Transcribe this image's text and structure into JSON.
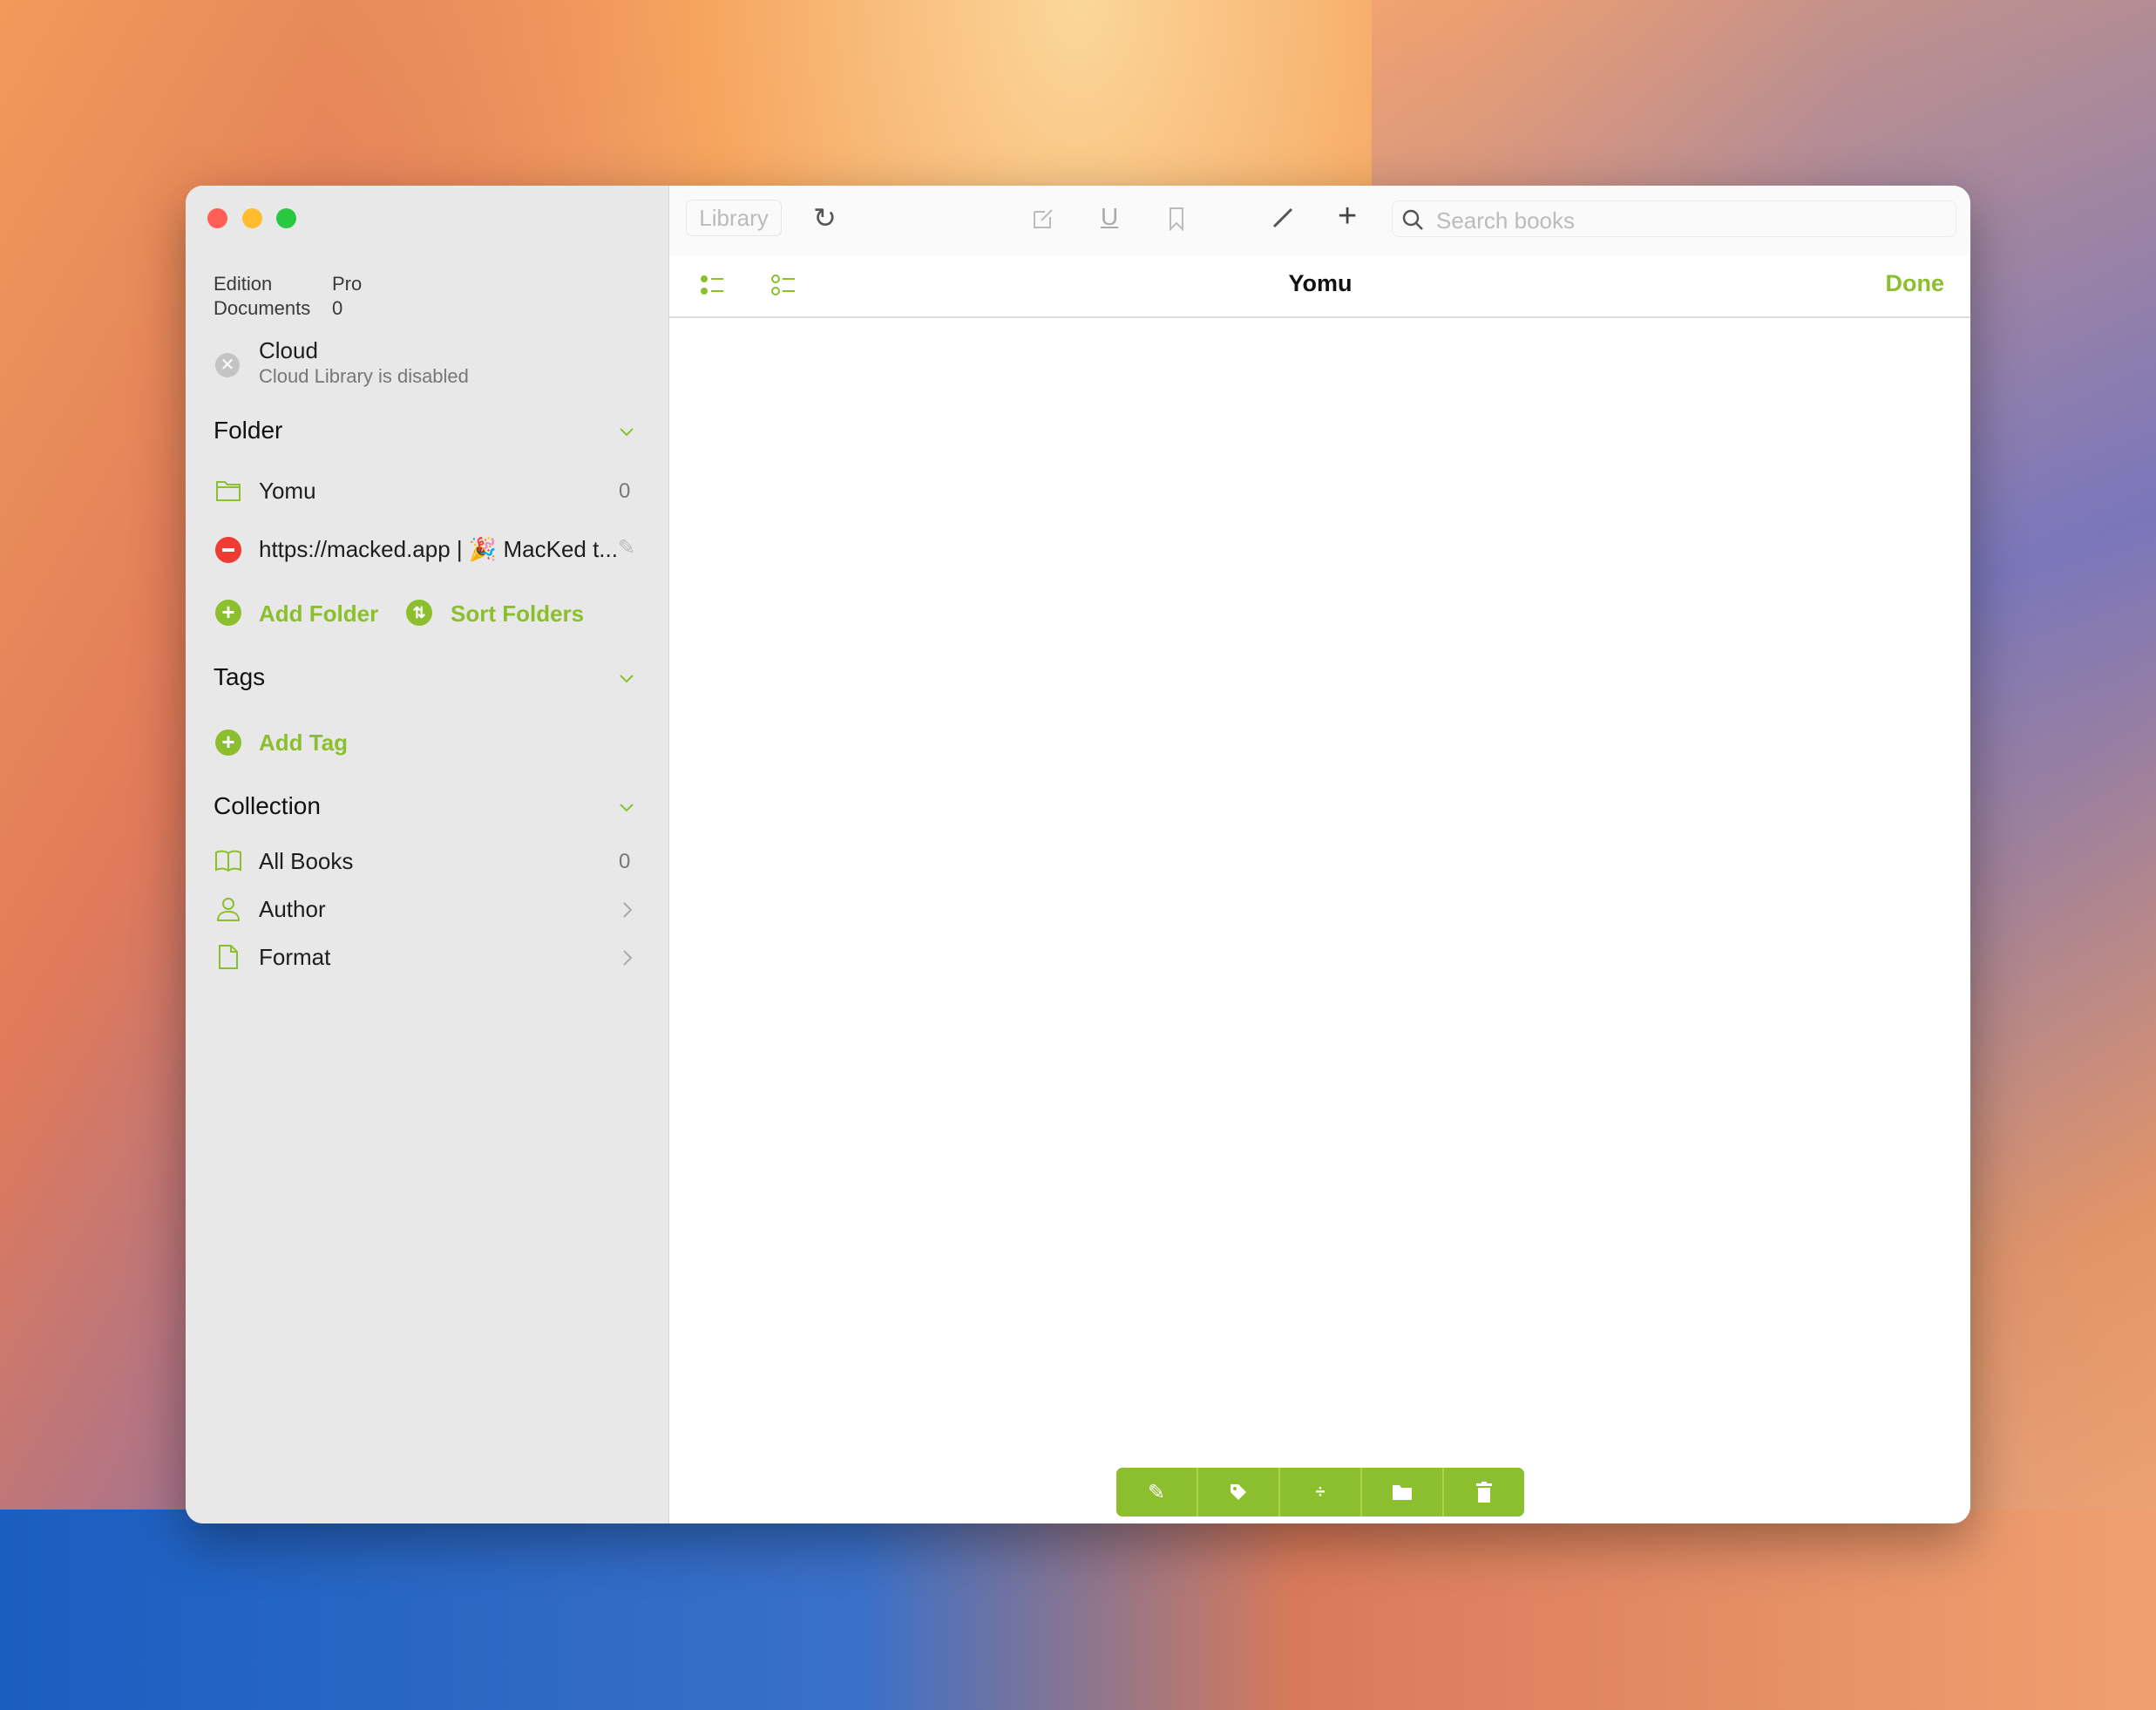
{
  "sidebar": {
    "edition_label": "Edition",
    "edition_value": "Pro",
    "documents_label": "Documents",
    "documents_value": "0",
    "cloud_title": "Cloud",
    "cloud_status": "Cloud Library is disabled",
    "folder_header": "Folder",
    "folders": [
      {
        "name": "Yomu",
        "count": "0"
      },
      {
        "name": "https://macked.app | 🎉 MacKed t..."
      }
    ],
    "add_folder": "Add Folder",
    "sort_folders": "Sort Folders",
    "tags_header": "Tags",
    "add_tag": "Add Tag",
    "collection_header": "Collection",
    "collection": [
      {
        "name": "All Books",
        "count": "0"
      },
      {
        "name": "Author"
      },
      {
        "name": "Format"
      }
    ]
  },
  "toolbar": {
    "library": "Library",
    "search_placeholder": "Search books"
  },
  "header": {
    "title": "Yomu",
    "done": "Done"
  },
  "colors": {
    "accent": "#8cbf2e",
    "close": "#fe5f57",
    "minimize": "#febc2e",
    "zoom": "#28c840"
  }
}
